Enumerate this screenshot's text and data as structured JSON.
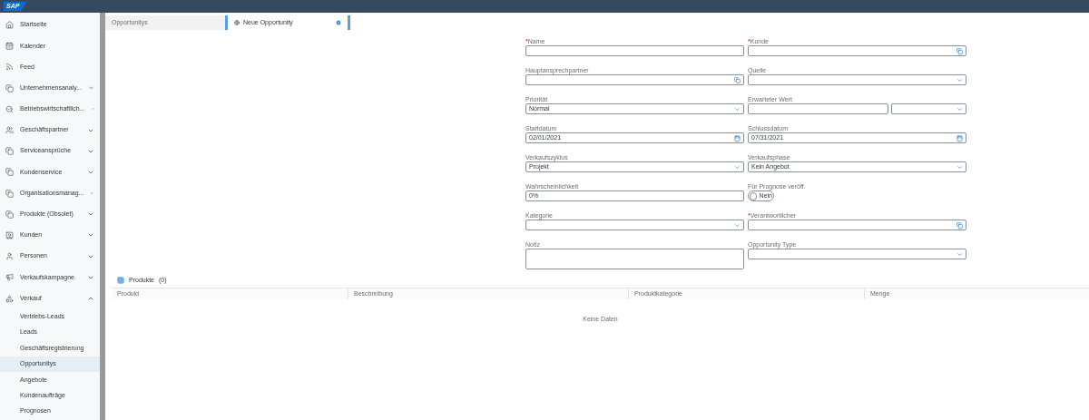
{
  "brand": "SAP",
  "sidebar": {
    "items": [
      {
        "label": "Startseite"
      },
      {
        "label": "Kalender"
      },
      {
        "label": "Feed"
      },
      {
        "label": "Unternehmensanaly...",
        "expanded": false
      },
      {
        "label": "Betriebswirtschaftlich...",
        "expanded": false
      },
      {
        "label": "Geschäftspartner",
        "expanded": false
      },
      {
        "label": "Serviceansprüche",
        "expanded": false
      },
      {
        "label": "Kundenservice",
        "expanded": false
      },
      {
        "label": "Organisationsmanag...",
        "expanded": false
      },
      {
        "label": "Produkte (Obsolet)",
        "expanded": false
      },
      {
        "label": "Kunden",
        "expanded": false
      },
      {
        "label": "Personen",
        "expanded": false
      },
      {
        "label": "Verkaufskampagne",
        "expanded": false
      },
      {
        "label": "Verkauf",
        "expanded": true,
        "children": [
          {
            "label": "Vertriebs-Leads",
            "selected": false
          },
          {
            "label": "Leads",
            "selected": false
          },
          {
            "label": "Geschäftsregistrierung",
            "selected": false
          },
          {
            "label": "Opportunitys",
            "selected": true
          },
          {
            "label": "Angebote",
            "selected": false
          },
          {
            "label": "Kundenaufträge",
            "selected": false
          },
          {
            "label": "Prognosen",
            "selected": false
          }
        ]
      }
    ]
  },
  "tabs": [
    {
      "label": "Opportunitys",
      "selected": false
    },
    {
      "label": "Neue Opportunity",
      "selected": true
    }
  ],
  "form": {
    "rows": [
      [
        {
          "label": "Name",
          "required_mark": "*",
          "kind": "text"
        },
        {
          "label": "Kunde",
          "required_mark": "*",
          "kind": "lookup"
        }
      ],
      [
        {
          "label": "Hauptansprechpartner",
          "kind": "lookup"
        },
        {
          "label": "Quelle",
          "kind": "select"
        }
      ],
      [
        {
          "label": "Priorität",
          "kind": "select",
          "value": "Normal"
        },
        {
          "label": "Erwarteter Wert",
          "kind": "split"
        }
      ],
      [
        {
          "label": "Startdatum",
          "kind": "date",
          "value": "02/01/2021"
        },
        {
          "label": "Schlussdatum",
          "kind": "date",
          "value": "07/31/2021"
        }
      ],
      [
        {
          "label": "Verkaufszyklus",
          "kind": "select",
          "value": "Projekt"
        },
        {
          "label": "Verkaufsphase",
          "kind": "select",
          "value": "Kein Angebot"
        }
      ],
      [
        {
          "label": "Wahrscheinlichkeit",
          "kind": "text",
          "value": "0%"
        },
        {
          "label": "Für Prognose veröff.",
          "kind": "toggle",
          "on": false,
          "value": "Nein"
        }
      ],
      [
        {
          "label": "Kategorie",
          "kind": "select"
        },
        {
          "label": "Verantwortlicher",
          "required_mark": "*",
          "kind": "lookup"
        }
      ],
      [
        {
          "label": "Notiz",
          "kind": "textarea"
        },
        {
          "label": "Opportunity Type",
          "kind": "select"
        }
      ]
    ]
  },
  "products": {
    "title": "Produkte",
    "count": "(0)",
    "columns": [
      "Produkt",
      "Beschreibung",
      "Produktkategorie",
      "Menge"
    ],
    "empty": "Keine Daten"
  }
}
